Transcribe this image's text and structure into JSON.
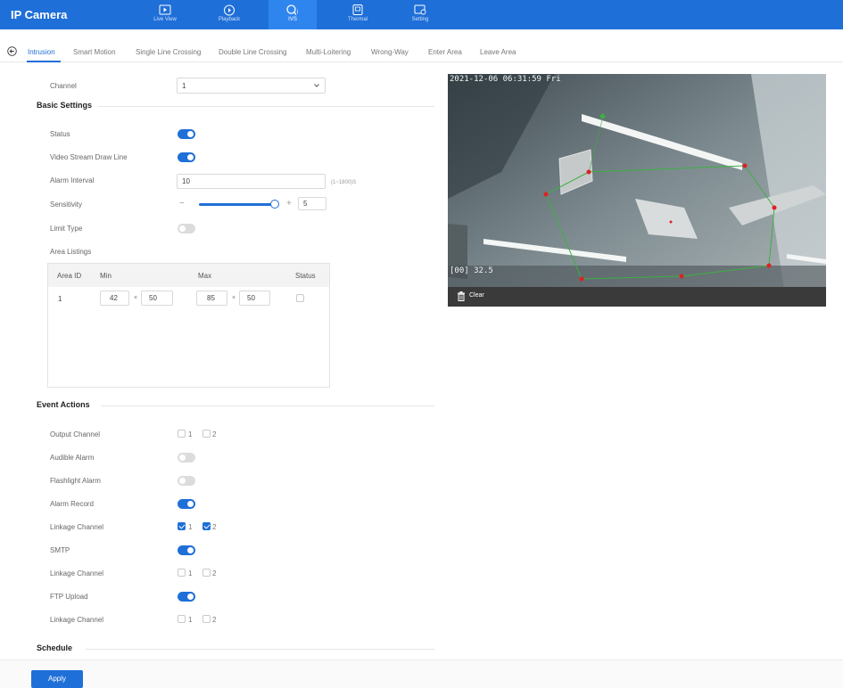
{
  "app": {
    "title": "IP Camera"
  },
  "nav": [
    {
      "label": "Live View",
      "icon": "live-view-icon"
    },
    {
      "label": "Playback",
      "icon": "playback-icon"
    },
    {
      "label": "IVS",
      "icon": "ivs-icon"
    },
    {
      "label": "Thermal",
      "icon": "thermal-icon"
    },
    {
      "label": "Setting",
      "icon": "setting-icon"
    }
  ],
  "nav_active": "IVS",
  "tabs": [
    "Intrusion",
    "Smart Motion",
    "Single Line Crossing",
    "Double Line Crossing",
    "Multi-Loitering",
    "Wrong-Way",
    "Enter Area",
    "Leave Area"
  ],
  "tabs_active": "Intrusion",
  "form": {
    "channel_label": "Channel",
    "channel_value": "1",
    "basic_settings_title": "Basic Settings",
    "status_label": "Status",
    "status_on": true,
    "draw_line_label": "Video Stream Draw Line",
    "draw_line_on": true,
    "alarm_interval_label": "Alarm Interval",
    "alarm_interval_value": "10",
    "alarm_interval_hint": "(1~1800)S",
    "sensitivity_label": "Sensitivity",
    "sensitivity_value": "5",
    "limit_type_label": "Limit Type",
    "limit_type_on": false,
    "area_listings_label": "Area Listings",
    "area_table": {
      "headers": [
        "Area ID",
        "Min",
        "Max",
        "Status"
      ],
      "rows": [
        {
          "id": "1",
          "min_w": "42",
          "min_h": "50",
          "max_w": "85",
          "max_h": "50",
          "status_checked": false
        }
      ]
    },
    "event_actions_title": "Event Actions",
    "output_channel_label": "Output Channel",
    "output_channel_options": [
      "1",
      "2"
    ],
    "audible_alarm_label": "Audible Alarm",
    "audible_alarm_on": false,
    "flashlight_alarm_label": "Flashlight Alarm",
    "flashlight_alarm_on": false,
    "alarm_record_label": "Alarm Record",
    "alarm_record_on": true,
    "linkage_channel_label": "Linkage Channel",
    "linkage1_options": [
      "1",
      "2"
    ],
    "linkage1_checked": [
      true,
      true
    ],
    "smtp_label": "SMTP",
    "smtp_on": true,
    "linkage2_options": [
      "1",
      "2"
    ],
    "linkage2_checked": [
      false,
      false
    ],
    "ftp_upload_label": "FTP Upload",
    "ftp_upload_on": true,
    "linkage3_options": [
      "1",
      "2"
    ],
    "linkage3_checked": [
      false,
      false
    ],
    "schedule_title": "Schedule",
    "apply_label": "Apply"
  },
  "preview": {
    "timestamp": "2021-12-06 06:31:59 Fri",
    "temperature": "[00] 32.5",
    "clear_label": "Clear"
  },
  "colors": {
    "accent": "#1f6fd8",
    "zone_line": "#3cb043",
    "zone_point": "#e02020"
  }
}
